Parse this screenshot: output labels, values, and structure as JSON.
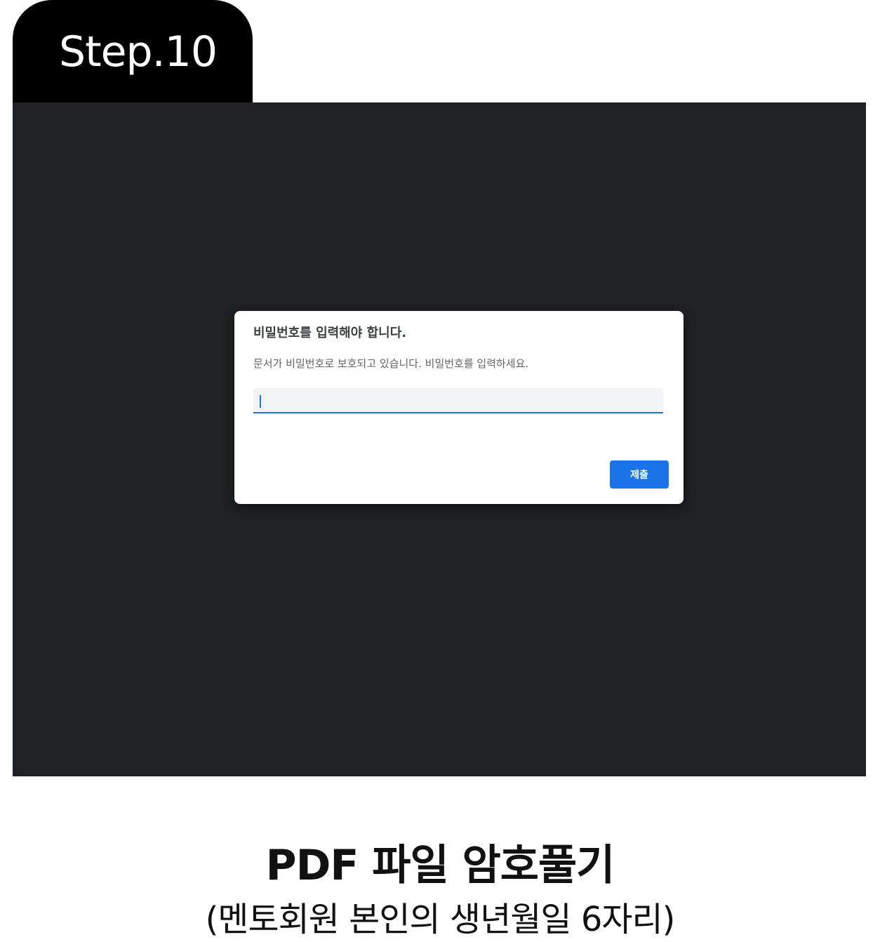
{
  "step": {
    "label": "Step.10"
  },
  "dialog": {
    "title": "비밀번호를 입력해야 합니다.",
    "message": "문서가 비밀번호로 보호되고 있습니다. 비밀번호를 입력하세요.",
    "password_value": "",
    "submit_label": "제출"
  },
  "caption": {
    "title": "PDF 파일 암호풀기",
    "subtitle": "(멘토회원 본인의 생년월일 6자리)"
  },
  "colors": {
    "tab_background": "#000000",
    "screen_background": "#202124",
    "dialog_background": "#ffffff",
    "accent": "#1a73e8",
    "input_background": "#f1f3f4"
  }
}
